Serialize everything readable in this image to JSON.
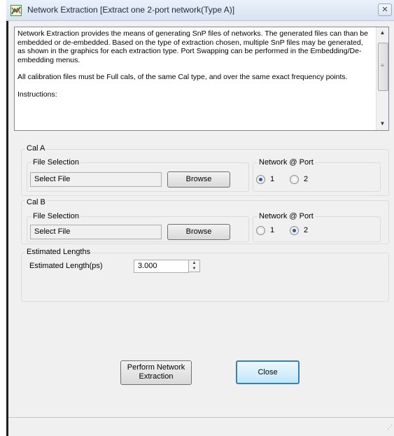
{
  "window": {
    "title": "Network Extraction [Extract one 2-port network(Type A)]",
    "close_glyph": "✕"
  },
  "info": {
    "paragraph1": "Network Extraction provides the means of generating SnP files of networks.  The generated files can than be embedded or de-embedded.  Based on the type of extraction chosen, multiple SnP files may be generated, as shown in the graphics for each extraction type.  Port Swapping can be performed in the Embedding/De-embedding menus.",
    "paragraph2": "All calibration files must be Full cals, of the same Cal type, and over the same exact frequency points.",
    "paragraph3": "Instructions:"
  },
  "cal_a": {
    "label": "Cal A",
    "file_selection_label": "File Selection",
    "file_value": "Select File",
    "browse_label": "Browse",
    "network_port_label": "Network @ Port",
    "port1_label": "1",
    "port2_label": "2",
    "selected_port": "1"
  },
  "cal_b": {
    "label": "Cal B",
    "file_selection_label": "File Selection",
    "file_value": "Select File",
    "browse_label": "Browse",
    "network_port_label": "Network @ Port",
    "port1_label": "1",
    "port2_label": "2",
    "selected_port": "2"
  },
  "estimated": {
    "label": "Estimated Lengths",
    "length_label": "Estimated Length(ps)",
    "length_value": "3.000"
  },
  "buttons": {
    "perform_line1": "Perform Network",
    "perform_line2": "Extraction",
    "close_label": "Close"
  },
  "colors": {
    "window_bg": "#f0f0f0",
    "radio_dot": "#2f5a9a",
    "close_button_border": "#3c7fb1"
  },
  "icons": {
    "app": "network-extraction-app-icon",
    "scroll_up": "triangle-up",
    "scroll_down": "triangle-down"
  }
}
